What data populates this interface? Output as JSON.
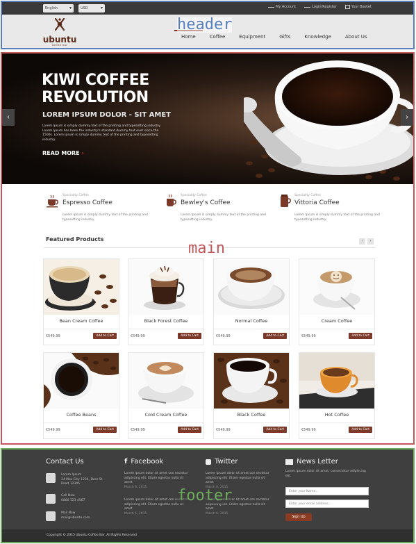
{
  "regions": {
    "header": "header",
    "main": "main",
    "footer": "footer"
  },
  "topbar": {
    "language": "English",
    "currency": "USD",
    "links": {
      "account": "My Account",
      "login": "Login/Register",
      "basket": "Your Basket"
    }
  },
  "logo": {
    "name": "ubuntu",
    "tagline": "coffee bar"
  },
  "nav": {
    "items": [
      "Home",
      "Coffee",
      "Equipment",
      "Gifts",
      "Knowledge",
      "About Us"
    ],
    "active": "Home"
  },
  "hero": {
    "title_line1": "KIWI COFFEE",
    "title_line2": "REVOLUTION",
    "subtitle": "LOREM IPSUM DOLOR - SIT AMET",
    "body": "Lorem Ipsum is simply dummy text of the printing and typesetting industry. Lorem Ipsum has been the industry's standard dummy text ever since the 1500s. Lorem Ipsum is simply dummy text of the printing and typesetting industry.",
    "cta": "READ MORE",
    "prev": "‹",
    "next": "›"
  },
  "specialties": [
    {
      "tag": "Speciality Coffee",
      "name": "Espresso Coffee",
      "desc": "Lorem Ipsum is simply dummy text of the printing and typesetting industry."
    },
    {
      "tag": "Speciality Coffee",
      "name": "Bewley's Coffee",
      "desc": "Lorem Ipsum is simply dummy text of the printing and typesetting industry."
    },
    {
      "tag": "Speciality Coffee",
      "name": "Vittoria Coffee",
      "desc": "Lorem Ipsum is simply dummy text of the printing and typesetting industry."
    }
  ],
  "featured": {
    "title": "Featured Products",
    "prev": "‹",
    "next": "›",
    "products": [
      {
        "name": "Bean Cream Coffee",
        "price": "€549.99",
        "cta": "Add to Cart"
      },
      {
        "name": "Black Forest Coffee",
        "price": "€549.99",
        "cta": "Add to Cart"
      },
      {
        "name": "Normal Coffee",
        "price": "€549.99",
        "cta": "Add to Cart"
      },
      {
        "name": "Cream Coffee",
        "price": "€549.99",
        "cta": "Add to Cart"
      },
      {
        "name": "Coffee Beans",
        "price": "€549.99",
        "cta": "Add to Cart"
      },
      {
        "name": "Cold Cream Coffee",
        "price": "€549.99",
        "cta": "Add to Cart"
      },
      {
        "name": "Black Coffee",
        "price": "€549.99",
        "cta": "Add to Cart"
      },
      {
        "name": "Hot Coffee",
        "price": "€549.99",
        "cta": "Add to Cart"
      }
    ]
  },
  "footer": {
    "contact": {
      "title": "Contact Us",
      "address_label": "Lorem Ipsum",
      "address": "34 Max City 1234, Doer St Road 12345",
      "phone_label": "Call Now",
      "phone": "0800 123 4567",
      "mail_label": "Mail Now",
      "mail": "mail@ubuntu.com"
    },
    "facebook": {
      "title": "Facebook",
      "posts": [
        {
          "text": "Lorem ipsum dolor sit amet con sectetur adipiscing elit. Etiam egestas nulla sit amet",
          "date": "March 6, 2015"
        },
        {
          "text": "Lorem ipsum dolor sit amet con sectetur adipiscing elit. Etiam egestas nulla sit amet",
          "date": "March 6, 2015"
        }
      ]
    },
    "twitter": {
      "title": "Twitter",
      "posts": [
        {
          "text": "Lorem ipsum dolor sit amet con sectetur adipiscing elit. Etiam egestas nulla sit amet",
          "date": "March 6, 2015"
        },
        {
          "text": "Lorem ipsum dolor sit amet con sectetur adipiscing elit. Etiam egestas nulla sit amet",
          "date": "March 6, 2015"
        }
      ]
    },
    "newsletter": {
      "title": "News Letter",
      "text": "Lorem ipsum dolor sit amet, consectetur adipiscing elit.",
      "name_placeholder": "Enter your Name...",
      "email_placeholder": "Enter your email address...",
      "cta": "Sign Up"
    },
    "copyright": "Copyright © 2015 Ubuntu Coffee Bar. All Rights Reserved"
  },
  "colors": {
    "accent": "#8a2b1b",
    "button": "#7b3a29",
    "footer_bg": "#3f3f3f",
    "topbar_bg": "#3a3a3a"
  }
}
